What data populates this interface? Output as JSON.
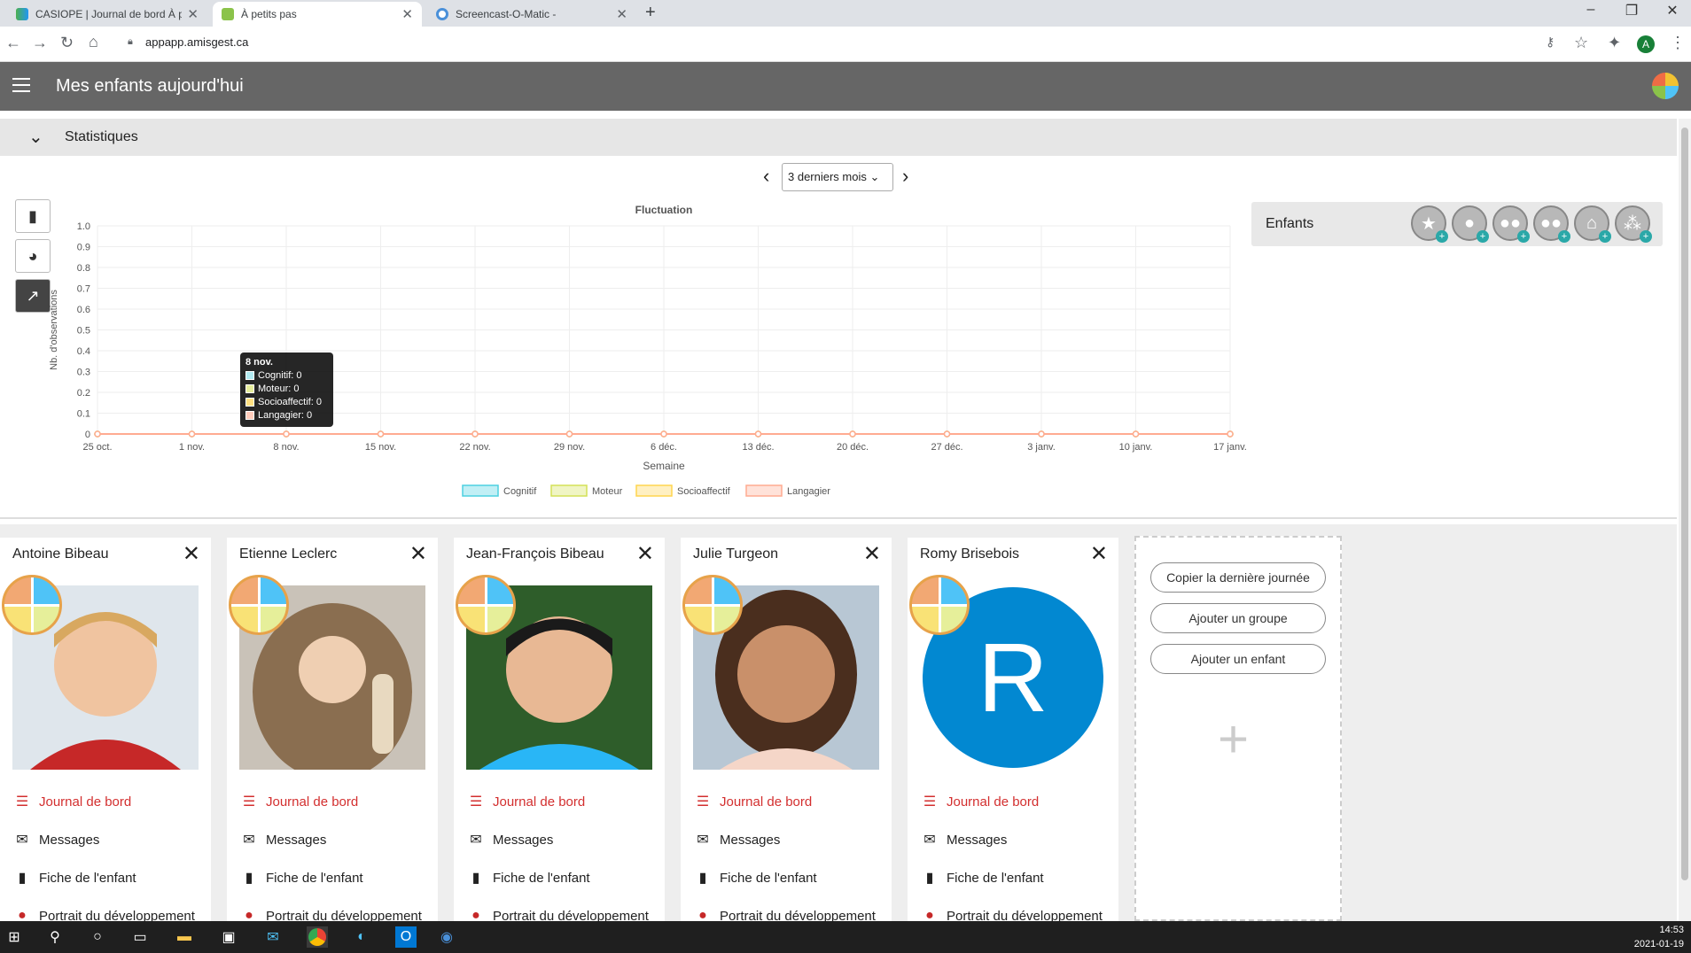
{
  "tabs": [
    {
      "label": "CASIOPE | Journal de bord À peti",
      "active": false
    },
    {
      "label": "À petits pas",
      "active": true
    },
    {
      "label": "Screencast-O-Matic -",
      "active": false
    }
  ],
  "address": {
    "url": "appapp.amisgest.ca"
  },
  "app": {
    "title": "Mes enfants aujourd'hui"
  },
  "stats": {
    "section_label": "Statistiques",
    "period": "3 derniers mois",
    "enfants_label": "Enfants"
  },
  "chart_data": {
    "type": "line",
    "title": "Fluctuation",
    "xlabel": "Semaine",
    "ylabel": "Nb. d'observations",
    "ylim": [
      0,
      1.0
    ],
    "yticks": [
      "0",
      "0.1",
      "0.2",
      "0.3",
      "0.4",
      "0.5",
      "0.6",
      "0.7",
      "0.8",
      "0.9",
      "1.0"
    ],
    "categories": [
      "25 oct.",
      "1 nov.",
      "8 nov.",
      "15 nov.",
      "22 nov.",
      "29 nov.",
      "6 déc.",
      "13 déc.",
      "20 déc.",
      "27 déc.",
      "3 janv.",
      "10 janv.",
      "17 janv."
    ],
    "series": [
      {
        "name": "Cognitif",
        "color": "#4dd0e1",
        "values": [
          0,
          0,
          0,
          0,
          0,
          0,
          0,
          0,
          0,
          0,
          0,
          0,
          0
        ]
      },
      {
        "name": "Moteur",
        "color": "#d4e157",
        "values": [
          0,
          0,
          0,
          0,
          0,
          0,
          0,
          0,
          0,
          0,
          0,
          0,
          0
        ]
      },
      {
        "name": "Socioaffectif",
        "color": "#ffd54f",
        "values": [
          0,
          0,
          0,
          0,
          0,
          0,
          0,
          0,
          0,
          0,
          0,
          0,
          0
        ]
      },
      {
        "name": "Langagier",
        "color": "#ffab91",
        "values": [
          0,
          0,
          0,
          0,
          0,
          0,
          0,
          0,
          0,
          0,
          0,
          0,
          0
        ]
      }
    ],
    "grid": true,
    "legend": "bottom",
    "tooltip": {
      "title": "8 nov.",
      "rows": [
        "Cognitif: 0",
        "Moteur: 0",
        "Socioaffectif: 0",
        "Langagier: 0"
      ]
    }
  },
  "children": [
    {
      "name": "Antoine Bibeau"
    },
    {
      "name": "Etienne Leclerc"
    },
    {
      "name": "Jean-François Bibeau"
    },
    {
      "name": "Julie Turgeon"
    },
    {
      "name": "Romy Brisebois",
      "initial": "R"
    }
  ],
  "card_links": {
    "journal": "Journal de bord",
    "messages": "Messages",
    "fiche": "Fiche de l'enfant",
    "portrait": "Portrait du développement"
  },
  "actions": {
    "copy": "Copier la dernière journée",
    "add_group": "Ajouter un groupe",
    "add_child": "Ajouter un enfant"
  },
  "clock": {
    "time": "14:53",
    "date": "2021-01-19"
  }
}
